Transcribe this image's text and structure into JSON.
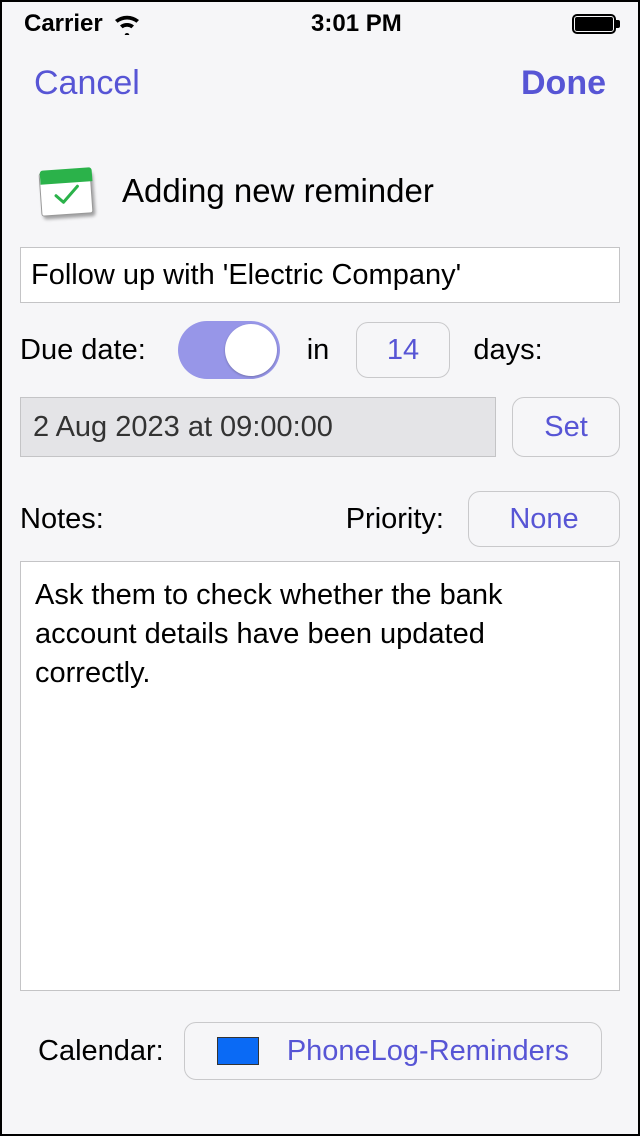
{
  "status": {
    "carrier": "Carrier",
    "time": "3:01 PM"
  },
  "nav": {
    "cancel": "Cancel",
    "done": "Done"
  },
  "header": {
    "title": "Adding new reminder"
  },
  "reminder": {
    "title_value": "Follow up with 'Electric Company'",
    "due_date_label": "Due date:",
    "due_toggle_on": true,
    "in_label": "in",
    "days_value": "14",
    "days_label": "days:",
    "datetime_display": "2 Aug 2023 at 09:00:00",
    "set_label": "Set",
    "notes_label": "Notes:",
    "priority_label": "Priority:",
    "priority_value": "None",
    "notes_value": "Ask them to check whether the bank account details have been updated correctly.",
    "calendar_label": "Calendar:",
    "calendar_value": "PhoneLog-Reminders",
    "calendar_color": "#0a6af5"
  }
}
